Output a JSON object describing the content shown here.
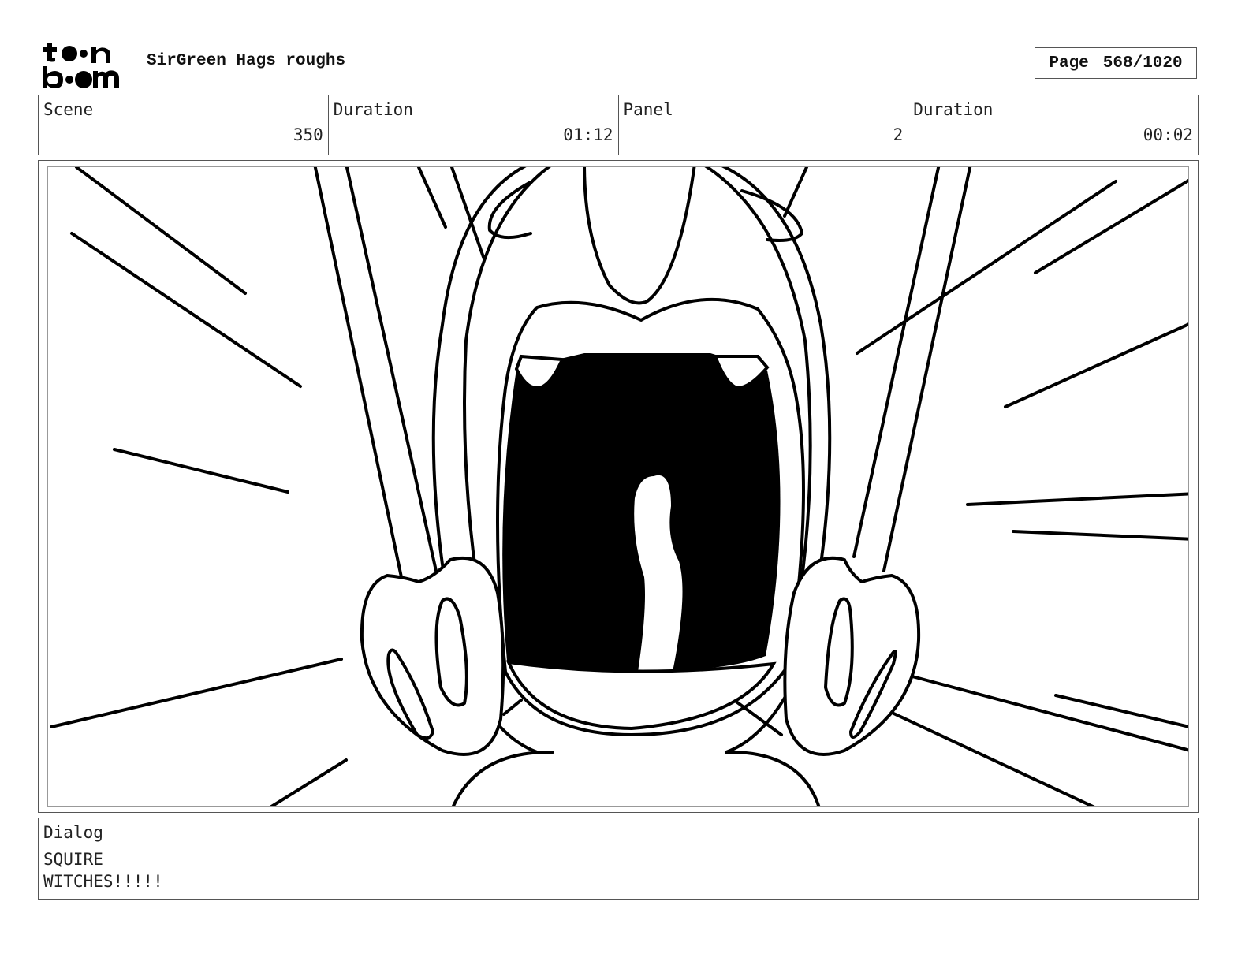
{
  "header": {
    "logo_alt": "toon boom",
    "project_title": "SirGreen Hags roughs",
    "page_label": "Page",
    "page_number": "568/1020"
  },
  "info": {
    "scene_label": "Scene",
    "scene_value": "350",
    "scene_duration_label": "Duration",
    "scene_duration_value": "01:12",
    "panel_label": "Panel",
    "panel_value": "2",
    "panel_duration_label": "Duration",
    "panel_duration_value": "00:02"
  },
  "dialog": {
    "label": "Dialog",
    "speaker": "SQUIRE",
    "line": "WITCHES!!!!!"
  },
  "colors": {
    "ink": "#000000",
    "paper": "#ffffff",
    "border": "#555555"
  }
}
